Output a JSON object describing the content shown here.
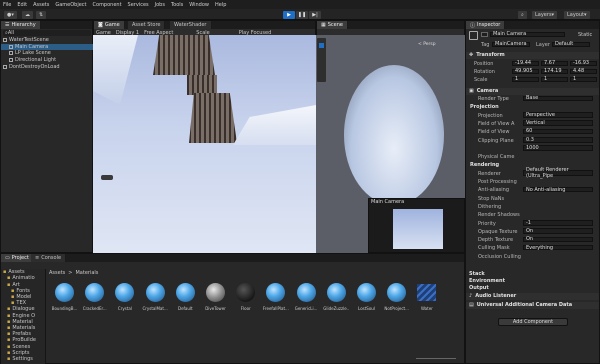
{
  "menu": [
    "File",
    "Edit",
    "Assets",
    "GameObject",
    "Component",
    "Services",
    "Jobs",
    "Tools",
    "Window",
    "Help"
  ],
  "toolbar": {
    "layers": "Layers",
    "layout": "Layout"
  },
  "hierarchy": {
    "tab": "Hierarchy",
    "search": "All",
    "items": [
      {
        "label": "WaterTestScene",
        "indent": 0,
        "selected": false
      },
      {
        "label": "Main Camera",
        "indent": 1,
        "selected": true
      },
      {
        "label": "LP Lake Scene",
        "indent": 1,
        "selected": false
      },
      {
        "label": "Directional Light",
        "indent": 1,
        "selected": false
      },
      {
        "label": "DontDestroyOnLoad",
        "indent": 0,
        "selected": false
      }
    ]
  },
  "game": {
    "tab": "Game",
    "tabs": [
      "Asset Store",
      "WaterShader"
    ],
    "display": "Game",
    "display_num": "Display 1",
    "aspect": "Free Aspect",
    "scale": "Scale",
    "play": "Play Focused"
  },
  "scene": {
    "tab": "Scene",
    "persp": "< Persp",
    "overlay_title": "Main Camera"
  },
  "inspector": {
    "tab": "Inspector",
    "name": "Main Camera",
    "tag_label": "Tag",
    "tag": "MainCamera",
    "layer_label": "Layer",
    "layer": "Default",
    "static": "Static",
    "transform": {
      "title": "Transform",
      "position": {
        "label": "Position",
        "x": "-19.44",
        "y": "7.67",
        "z": "-16.93"
      },
      "rotation": {
        "label": "Rotation",
        "x": "49.905",
        "y": "174.19",
        "z": "4.48"
      },
      "scale": {
        "label": "Scale",
        "x": "1",
        "y": "1",
        "z": "1"
      }
    },
    "camera": {
      "title": "Camera",
      "render_type_label": "Render Type",
      "render_type": "Base",
      "projection_header": "Projection",
      "projection_label": "Projection",
      "projection": "Perspective",
      "fov_axis_label": "Field of View A",
      "fov_axis": "Vertical",
      "fov_label": "Field of View",
      "fov": "60",
      "clip_label": "Clipping Plane",
      "near_label": "Near",
      "near": "0.3",
      "far_label": "Far",
      "far": "1000",
      "physical_label": "Physical Came",
      "rendering_header": "Rendering",
      "renderer_label": "Renderer",
      "renderer": "Default Renderer (Ultra_Pipe",
      "post_label": "Post Processing",
      "aa_label": "Anti-aliasing",
      "aa": "No Anti-aliasing",
      "stop_nan_label": "Stop NaNs",
      "dither_label": "Dithering",
      "shadows_label": "Render Shadows",
      "priority_label": "Priority",
      "priority": "-1",
      "opaque_label": "Opaque Texture",
      "opaque": "On",
      "depth_label": "Depth Texture",
      "depth": "On",
      "cull_label": "Culling Mask",
      "cull": "Everything",
      "occl_label": "Occlusion Culling"
    },
    "sections": [
      "Stack",
      "Environment",
      "Output"
    ],
    "audio": "Audio Listener",
    "urp": "Universal Additional Camera Data",
    "add_button": "Add Component"
  },
  "project": {
    "tabs": [
      "Project",
      "Console"
    ],
    "tree": [
      "Assets",
      "Animatio",
      "Art",
      "Fonts",
      "Model",
      "TEX",
      "Dialogue",
      "Engine O",
      "Material",
      "Materials",
      "Prefabs",
      "ProBuilde",
      "Scenes",
      "Scripts",
      "Settings"
    ],
    "path": [
      "Assets",
      ">",
      "Materials"
    ],
    "assets": [
      {
        "name": "BoundingB...",
        "kind": "blue"
      },
      {
        "name": "CrackedEr...",
        "kind": "blue"
      },
      {
        "name": "Crystal",
        "kind": "blue"
      },
      {
        "name": "CrystalMat...",
        "kind": "blue"
      },
      {
        "name": "Default",
        "kind": "blue"
      },
      {
        "name": "DiveTower",
        "kind": "grey"
      },
      {
        "name": "Floor",
        "kind": "black"
      },
      {
        "name": "FreefallPlat...",
        "kind": "blue"
      },
      {
        "name": "GenericLi...",
        "kind": "blue"
      },
      {
        "name": "GlideZuzzle...",
        "kind": "blue"
      },
      {
        "name": "LostSoul",
        "kind": "blue"
      },
      {
        "name": "NotProject...",
        "kind": "blue"
      },
      {
        "name": "Water",
        "kind": "water"
      }
    ]
  }
}
